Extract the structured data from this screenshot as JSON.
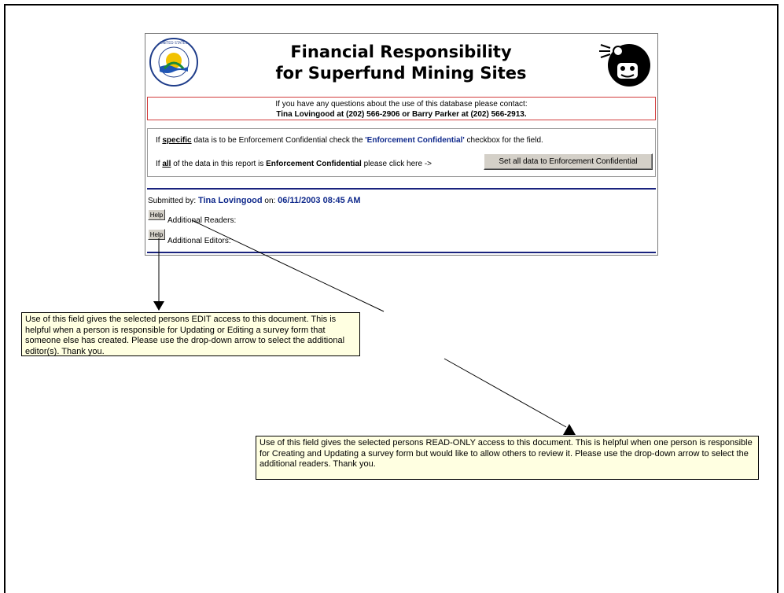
{
  "header": {
    "title_line1": "Financial Responsibility",
    "title_line2": "for Superfund Mining Sites",
    "seal_text": "UNITED STATES ENVIRONMENTAL PROTECTION AGENCY"
  },
  "contact": {
    "line1": "If you have any questions about the use of this database please contact:",
    "line2": "Tina Lovingood at (202) 566-2906 or Barry Parker at (202) 566-2913."
  },
  "confidential": {
    "line1_prefix": "If",
    "line1_emph": "specific",
    "line1_mid": "data is to be Enforcement Confidential check the",
    "line1_quote": "'Enforcement Confidential'",
    "line1_suffix": "checkbox for the field.",
    "line2_prefix": "If",
    "line2_emph": "all",
    "line2_mid": "of the data in this report is",
    "line2_bold": "Enforcement Confidential",
    "line2_suffix": "please click here ->",
    "button_label": "Set all data to Enforcement Confidential"
  },
  "submission": {
    "label": "Submitted by:",
    "submitter": "Tina Lovingood",
    "on_label": "on:",
    "datetime": "06/11/2003 08:45 AM"
  },
  "fields": {
    "help_label": "Help",
    "readers_label": "Additional Readers:",
    "editors_label": "Additional Editors:"
  },
  "callouts": {
    "editors": "Use of this field gives the selected persons EDIT access to this document.  This is helpful when a person is responsible for Updating or Editing a survey form that someone else has created.  Please use the drop-down arrow to select the additional editor(s).  Thank you.",
    "readers": "Use of this field gives the selected persons READ-ONLY access to this document.  This is helpful when one person is responsible for Creating and Updating a survey form but would like to allow others to review it.  Please use the drop-down arrow to select the additional readers.  Thank you."
  },
  "colors": {
    "accent_blue": "#102a8c",
    "rule_navy": "#1a237e",
    "contact_border": "#d23c3c",
    "callout_bg": "#ffffe1"
  }
}
